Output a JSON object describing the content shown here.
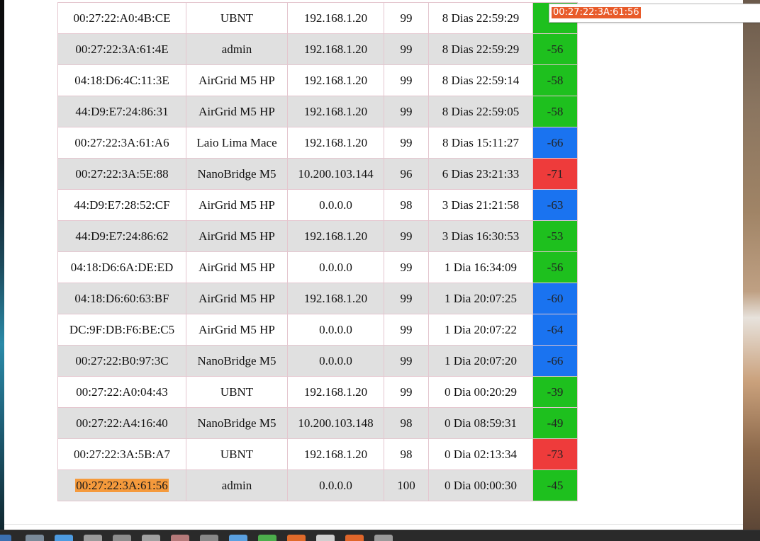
{
  "find_bar": {
    "query": "00:27:22:3A:61:56"
  },
  "table": {
    "rows": [
      {
        "mac": "00:27:22:A0:4B:CE",
        "name": "UBNT",
        "ip": "192.168.1.20",
        "ccq": "99",
        "uptime": "8 Dias 22:59:29",
        "signal": "",
        "signal_color": "green"
      },
      {
        "mac": "00:27:22:3A:61:4E",
        "name": "admin",
        "ip": "192.168.1.20",
        "ccq": "99",
        "uptime": "8 Dias 22:59:29",
        "signal": "-56",
        "signal_color": "green"
      },
      {
        "mac": "04:18:D6:4C:11:3E",
        "name": "AirGrid M5 HP",
        "ip": "192.168.1.20",
        "ccq": "99",
        "uptime": "8 Dias 22:59:14",
        "signal": "-58",
        "signal_color": "green"
      },
      {
        "mac": "44:D9:E7:24:86:31",
        "name": "AirGrid M5 HP",
        "ip": "192.168.1.20",
        "ccq": "99",
        "uptime": "8 Dias 22:59:05",
        "signal": "-58",
        "signal_color": "green"
      },
      {
        "mac": "00:27:22:3A:61:A6",
        "name": "Laio Lima Mace",
        "ip": "192.168.1.20",
        "ccq": "99",
        "uptime": "8 Dias 15:11:27",
        "signal": "-66",
        "signal_color": "blue"
      },
      {
        "mac": "00:27:22:3A:5E:88",
        "name": "NanoBridge M5",
        "ip": "10.200.103.144",
        "ccq": "96",
        "uptime": "6 Dias 23:21:33",
        "signal": "-71",
        "signal_color": "red"
      },
      {
        "mac": "44:D9:E7:28:52:CF",
        "name": "AirGrid M5 HP",
        "ip": "0.0.0.0",
        "ccq": "98",
        "uptime": "3 Dias 21:21:58",
        "signal": "-63",
        "signal_color": "blue"
      },
      {
        "mac": "44:D9:E7:24:86:62",
        "name": "AirGrid M5 HP",
        "ip": "192.168.1.20",
        "ccq": "99",
        "uptime": "3 Dias 16:30:53",
        "signal": "-53",
        "signal_color": "green"
      },
      {
        "mac": "04:18:D6:6A:DE:ED",
        "name": "AirGrid M5 HP",
        "ip": "0.0.0.0",
        "ccq": "99",
        "uptime": "1 Dia 16:34:09",
        "signal": "-56",
        "signal_color": "green"
      },
      {
        "mac": "04:18:D6:60:63:BF",
        "name": "AirGrid M5 HP",
        "ip": "192.168.1.20",
        "ccq": "99",
        "uptime": "1 Dia 20:07:25",
        "signal": "-60",
        "signal_color": "blue"
      },
      {
        "mac": "DC:9F:DB:F6:BE:C5",
        "name": "AirGrid M5 HP",
        "ip": "0.0.0.0",
        "ccq": "99",
        "uptime": "1 Dia 20:07:22",
        "signal": "-64",
        "signal_color": "blue"
      },
      {
        "mac": "00:27:22:B0:97:3C",
        "name": "NanoBridge M5",
        "ip": "0.0.0.0",
        "ccq": "99",
        "uptime": "1 Dia 20:07:20",
        "signal": "-66",
        "signal_color": "blue"
      },
      {
        "mac": "00:27:22:A0:04:43",
        "name": "UBNT",
        "ip": "192.168.1.20",
        "ccq": "99",
        "uptime": "0 Dia 00:20:29",
        "signal": "-39",
        "signal_color": "green"
      },
      {
        "mac": "00:27:22:A4:16:40",
        "name": "NanoBridge M5",
        "ip": "10.200.103.148",
        "ccq": "98",
        "uptime": "0 Dia 08:59:31",
        "signal": "-49",
        "signal_color": "green"
      },
      {
        "mac": "00:27:22:3A:5B:A7",
        "name": "UBNT",
        "ip": "192.168.1.20",
        "ccq": "98",
        "uptime": "0 Dia 02:13:34",
        "signal": "-73",
        "signal_color": "red"
      },
      {
        "mac": "00:27:22:3A:61:56",
        "name": "admin",
        "ip": "0.0.0.0",
        "ccq": "100",
        "uptime": "0 Dia 00:00:30",
        "signal": "-45",
        "signal_color": "green",
        "highlighted": true
      }
    ]
  },
  "taskbar": {
    "icons": [
      "browser-icon",
      "trash-icon",
      "monitor-icon",
      "folder-icon",
      "drive-icon",
      "printer-icon",
      "calendar-icon",
      "settings-icon",
      "document-icon",
      "spreadsheet-icon",
      "presentation-icon",
      "terminal-icon",
      "package-icon",
      "network-icon"
    ]
  },
  "colors": {
    "signal_green": "#1ec01e",
    "signal_blue": "#1a73f0",
    "signal_red": "#ee3b3b",
    "highlight": "#f59a3c",
    "find_selection": "#e85b2a",
    "row_alt": "#e0e0e0"
  }
}
